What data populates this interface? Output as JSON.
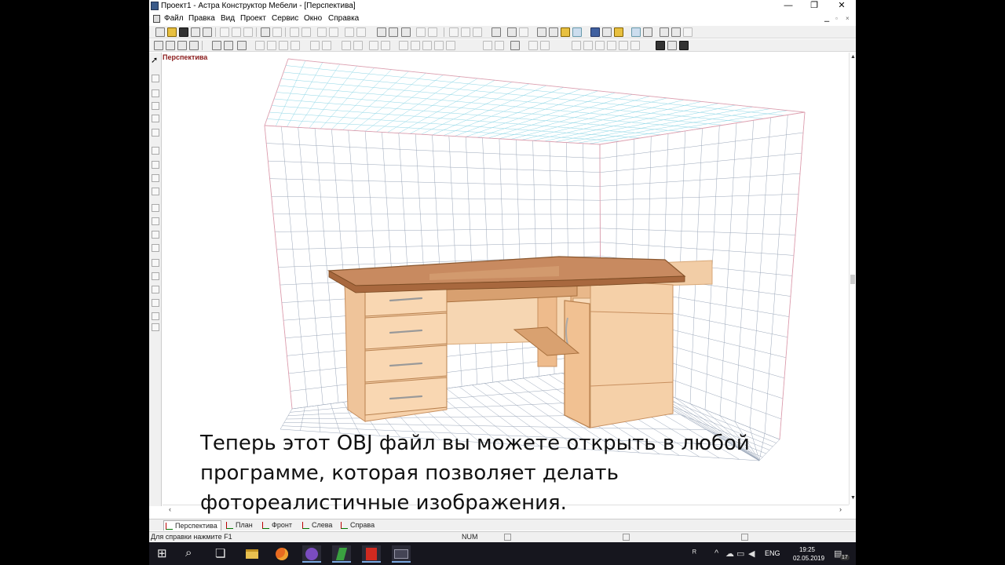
{
  "window": {
    "title": "Проект1 - Астра Конструктор Мебели - [Перспектива]",
    "controls": [
      "—",
      "❐",
      "✕"
    ]
  },
  "menu": {
    "items": [
      "Файл",
      "Правка",
      "Вид",
      "Проект",
      "Сервис",
      "Окно",
      "Справка"
    ]
  },
  "viewport": {
    "label": "Перспектива"
  },
  "view_tabs": [
    "Перспектива",
    "План",
    "Фронт",
    "Слева",
    "Справа"
  ],
  "status": {
    "hint": "Для справки нажмите F1",
    "num": "NUM"
  },
  "subtitle": {
    "line1": "Теперь этот OBJ файл вы можете открыть в любой",
    "line2": "программе, которая позволяет делать",
    "line3": "фотореалистичные изображения."
  },
  "taskbar": {
    "lang": "ENG",
    "time": "19:25",
    "date": "02.05.2019",
    "notifications": "17",
    "apps": [
      "windows-start-icon",
      "search-icon",
      "task-view-icon",
      "file-explorer-icon",
      "firefox-icon",
      "viber-icon",
      "astra-app-icon",
      "pdf-app-icon",
      "terminal-app-icon"
    ]
  },
  "colors": {
    "viewport_label": "#8a1a1a",
    "grid_line": "#9aa6b8",
    "ceiling_line": "#8cd6e6",
    "room_edge": "#e0a0b0",
    "desk_top": "#c88a60",
    "desk_body": "#f4cda4"
  }
}
